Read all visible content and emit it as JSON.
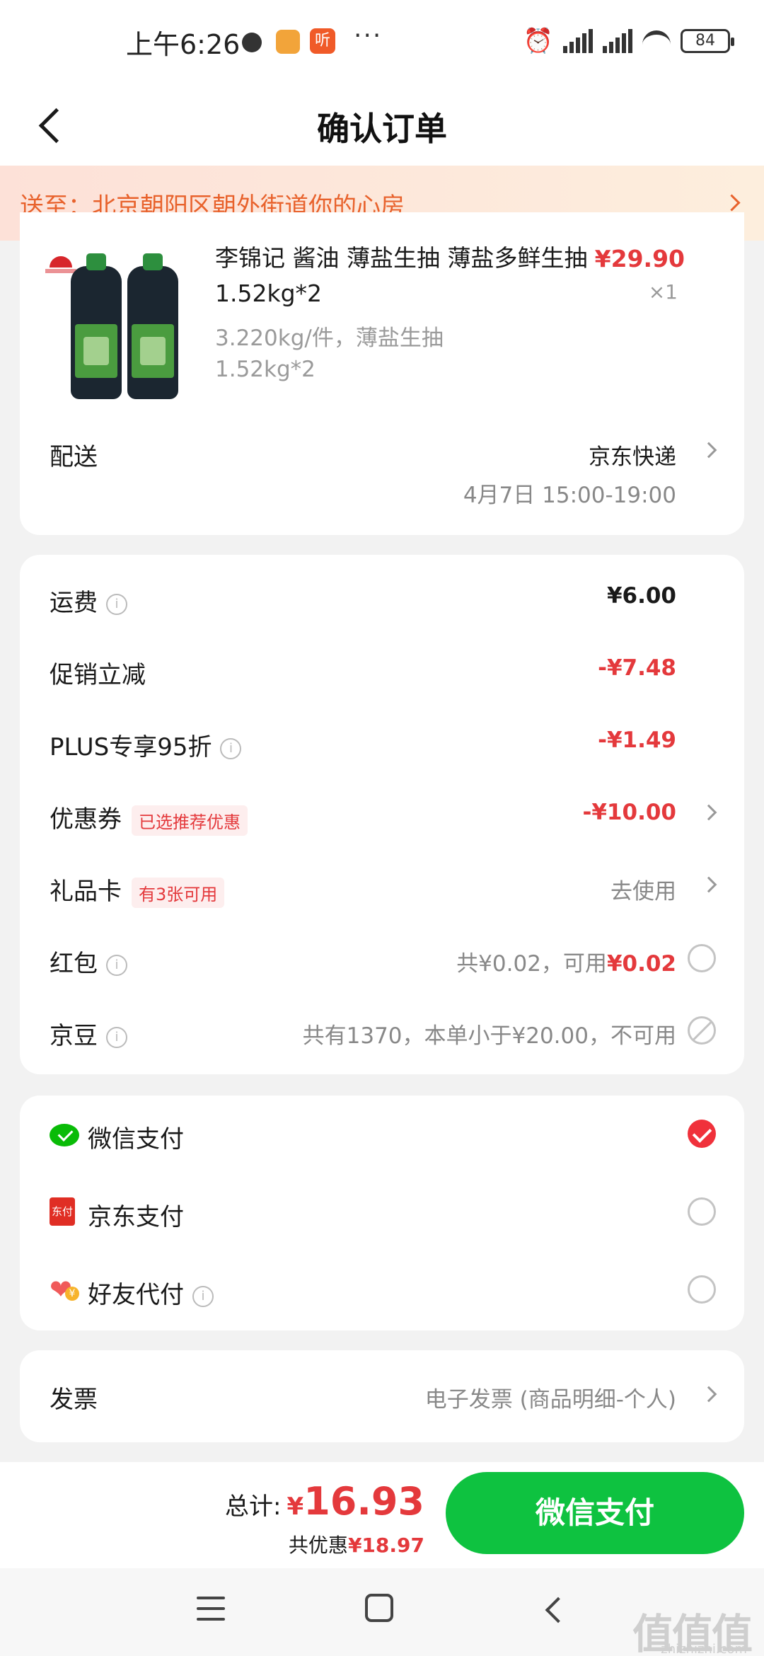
{
  "status_bar": {
    "time": "上午6:26",
    "app_badge": "听",
    "more": "···",
    "battery": "84"
  },
  "header": {
    "title": "确认订单"
  },
  "address": {
    "text": "送至：北京朝阳区朝外街道你的心房"
  },
  "product": {
    "title": "李锦记 酱油 薄盐生抽 薄盐多鲜生抽 1.52kg*2",
    "spec": "3.220kg/件，薄盐生抽 1.52kg*2",
    "price": "¥29.90",
    "qty": "×1"
  },
  "delivery": {
    "label": "配送",
    "carrier": "京东快递",
    "time": "4月7日 15:00-19:00"
  },
  "fees": {
    "shipping": {
      "label": "运费",
      "value": "¥6.00"
    },
    "promo": {
      "label": "促销立减",
      "value": "-¥7.48"
    },
    "plus": {
      "label": "PLUS专享95折",
      "value": "-¥1.49"
    },
    "coupon": {
      "label": "优惠券",
      "tag": "已选推荐优惠",
      "value": "-¥10.00"
    },
    "giftcard": {
      "label": "礼品卡",
      "tag": "有3张可用",
      "value": "去使用"
    },
    "redpacket": {
      "label": "红包",
      "value_prefix": "共¥0.02，可用",
      "value_amount": "¥0.02"
    },
    "jingdou": {
      "label": "京豆",
      "value": "共有1370，本单小于¥20.00，不可用"
    }
  },
  "payment": {
    "wechat": {
      "label": "微信支付",
      "selected": true
    },
    "jdpay": {
      "label": "京东支付",
      "icon_text": "东付",
      "selected": false
    },
    "friend": {
      "label": "好友代付",
      "selected": false
    }
  },
  "invoice": {
    "label": "发票",
    "value": "电子发票 (商品明细-个人)"
  },
  "bottom": {
    "total_label": "总计:",
    "currency": "¥",
    "total": "16.93",
    "saving_label": "共优惠",
    "saving": "¥18.97",
    "pay_button": "微信支付"
  },
  "watermark": {
    "text": "值值值",
    "sub": "zhizhizhi.com"
  },
  "colors": {
    "accent_red": "#e4393c",
    "pay_green": "#0ec240",
    "address_orange": "#e8622c"
  }
}
